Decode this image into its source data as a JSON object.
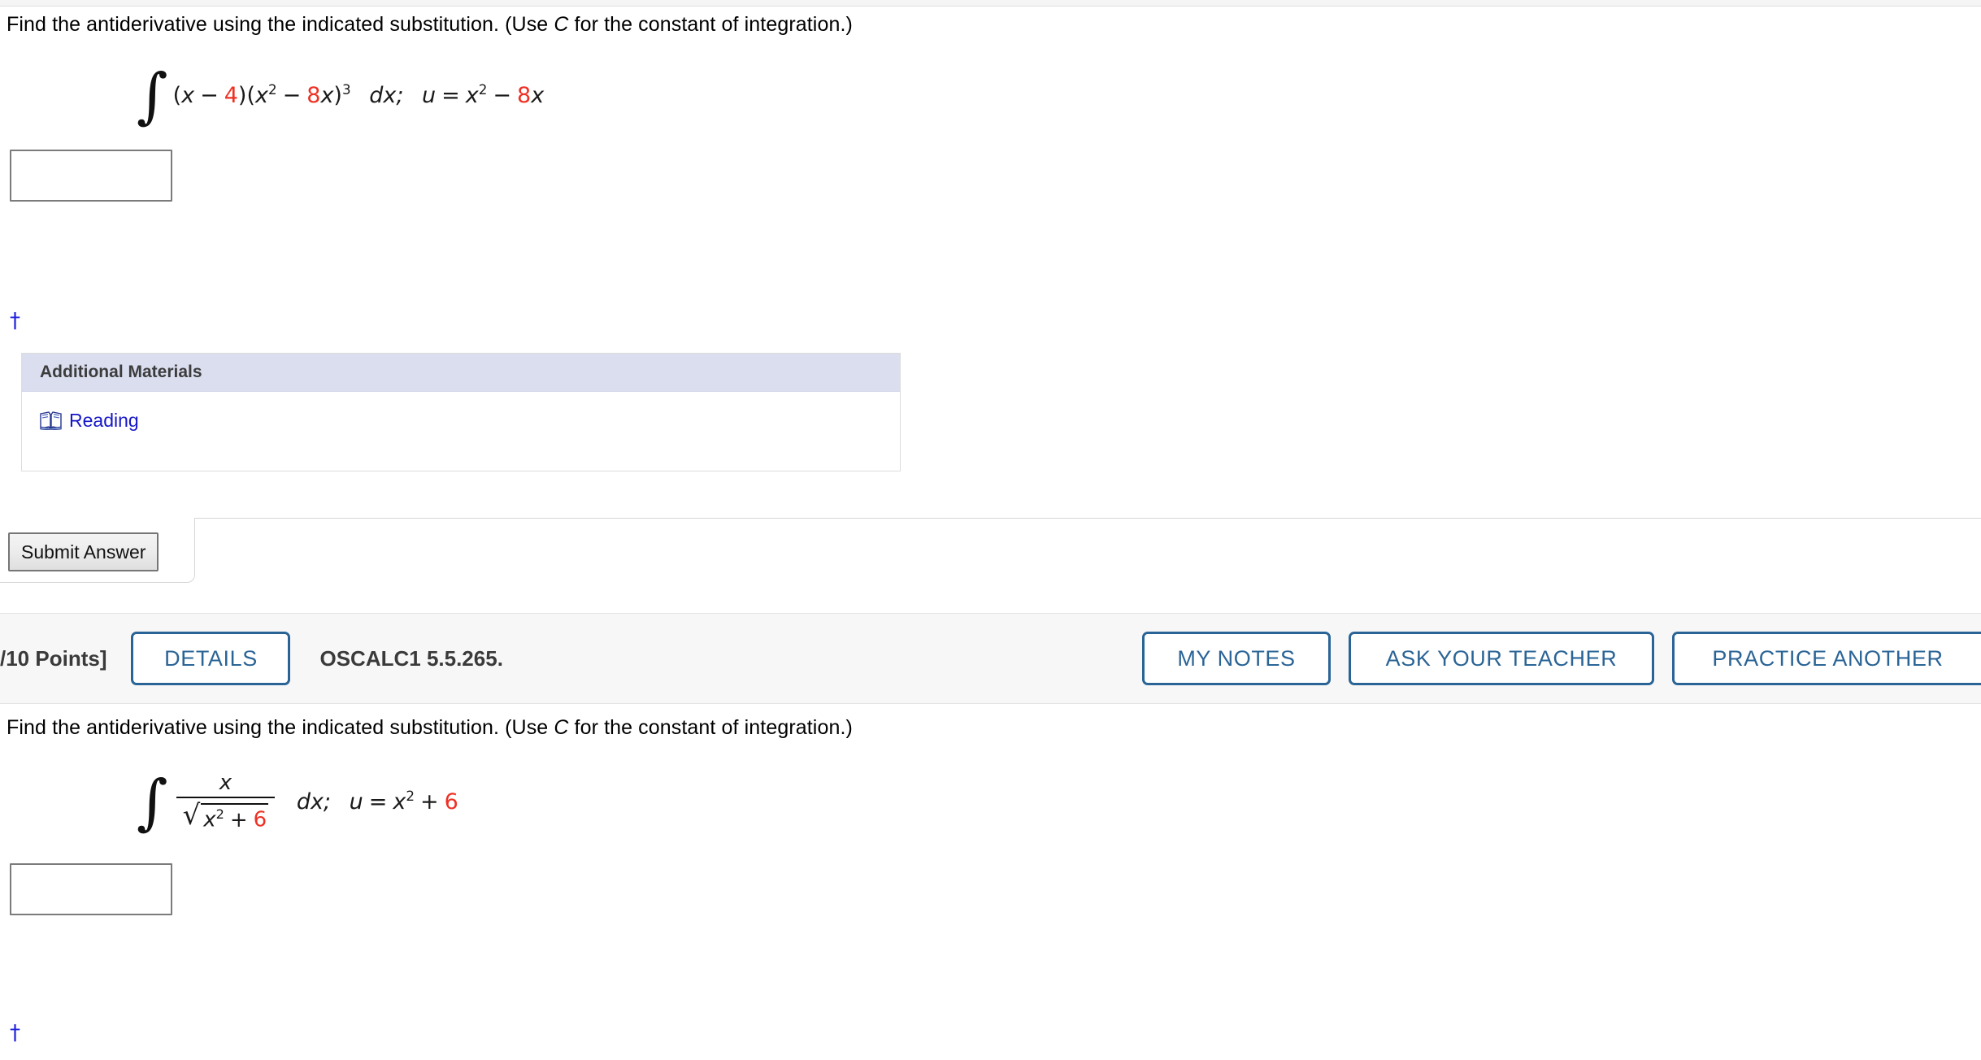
{
  "page": {
    "background": "#ffffff",
    "accent_blue": "#2a6496",
    "link_blue": "#1616c8",
    "math_red": "#ee3124",
    "panel_header_bg": "#dadeef",
    "header_band_bg": "#f7f7f7"
  },
  "question1": {
    "prompt_part1": "Find the antiderivative using the indicated substitution. (Use ",
    "prompt_var": "C",
    "prompt_part2": " for the constant of integration.)",
    "integral": {
      "integral_sign": "∫",
      "tokens": [
        "(",
        "x",
        " − ",
        "4",
        ")(",
        "x",
        "2",
        " − ",
        "8",
        "x",
        ")",
        "3",
        " dx; ",
        "u",
        " = ",
        "x",
        "2",
        " − ",
        "8",
        "x"
      ],
      "plain": "∫ (x − 4)(x² − 8x)³ dx; u = x² − 8x",
      "red_numbers": [
        "4",
        "8",
        "8"
      ],
      "left_paren": "(",
      "var_x": "x",
      "minus": "−",
      "coef4": "4",
      "rparen_lparen": ")(",
      "exp2": "2",
      "coef8": "8",
      "rparen": ")",
      "exp3": "3",
      "dx_text": "dx;",
      "var_u": "u",
      "equals": "=",
      "coef8b": "8"
    },
    "answer_value": "",
    "answer_placeholder": "",
    "dagger": "†",
    "additional_materials": {
      "title": "Additional Materials",
      "items": [
        {
          "label": "Reading",
          "icon": "book-icon"
        }
      ]
    },
    "submit_label": "Submit Answer"
  },
  "question2": {
    "header": {
      "points": "/10 Points]",
      "details_label": "DETAILS",
      "question_code": "OSCALC1 5.5.265.",
      "my_notes_label": "MY NOTES",
      "ask_teacher_label": "ASK YOUR TEACHER",
      "practice_another_label": "PRACTICE ANOTHER"
    },
    "prompt_part1": "Find the antiderivative using the indicated substitution. (Use ",
    "prompt_var": "C",
    "prompt_part2": " for the constant of integration.)",
    "integral": {
      "integral_sign": "∫",
      "plain": "∫ x/√(x² + 6) dx; u = x² + 6",
      "numerator": "x",
      "sqrt_symbol": "√",
      "denom_var": "x",
      "denom_exp": "2",
      "plus": "+",
      "denom_const": "6",
      "dx_text": "dx;",
      "var_u": "u",
      "equals": "=",
      "u_var": "x",
      "u_exp": "2",
      "u_plus": "+",
      "u_const": "6"
    },
    "answer_value": "",
    "answer_placeholder": "",
    "dagger": "†"
  }
}
